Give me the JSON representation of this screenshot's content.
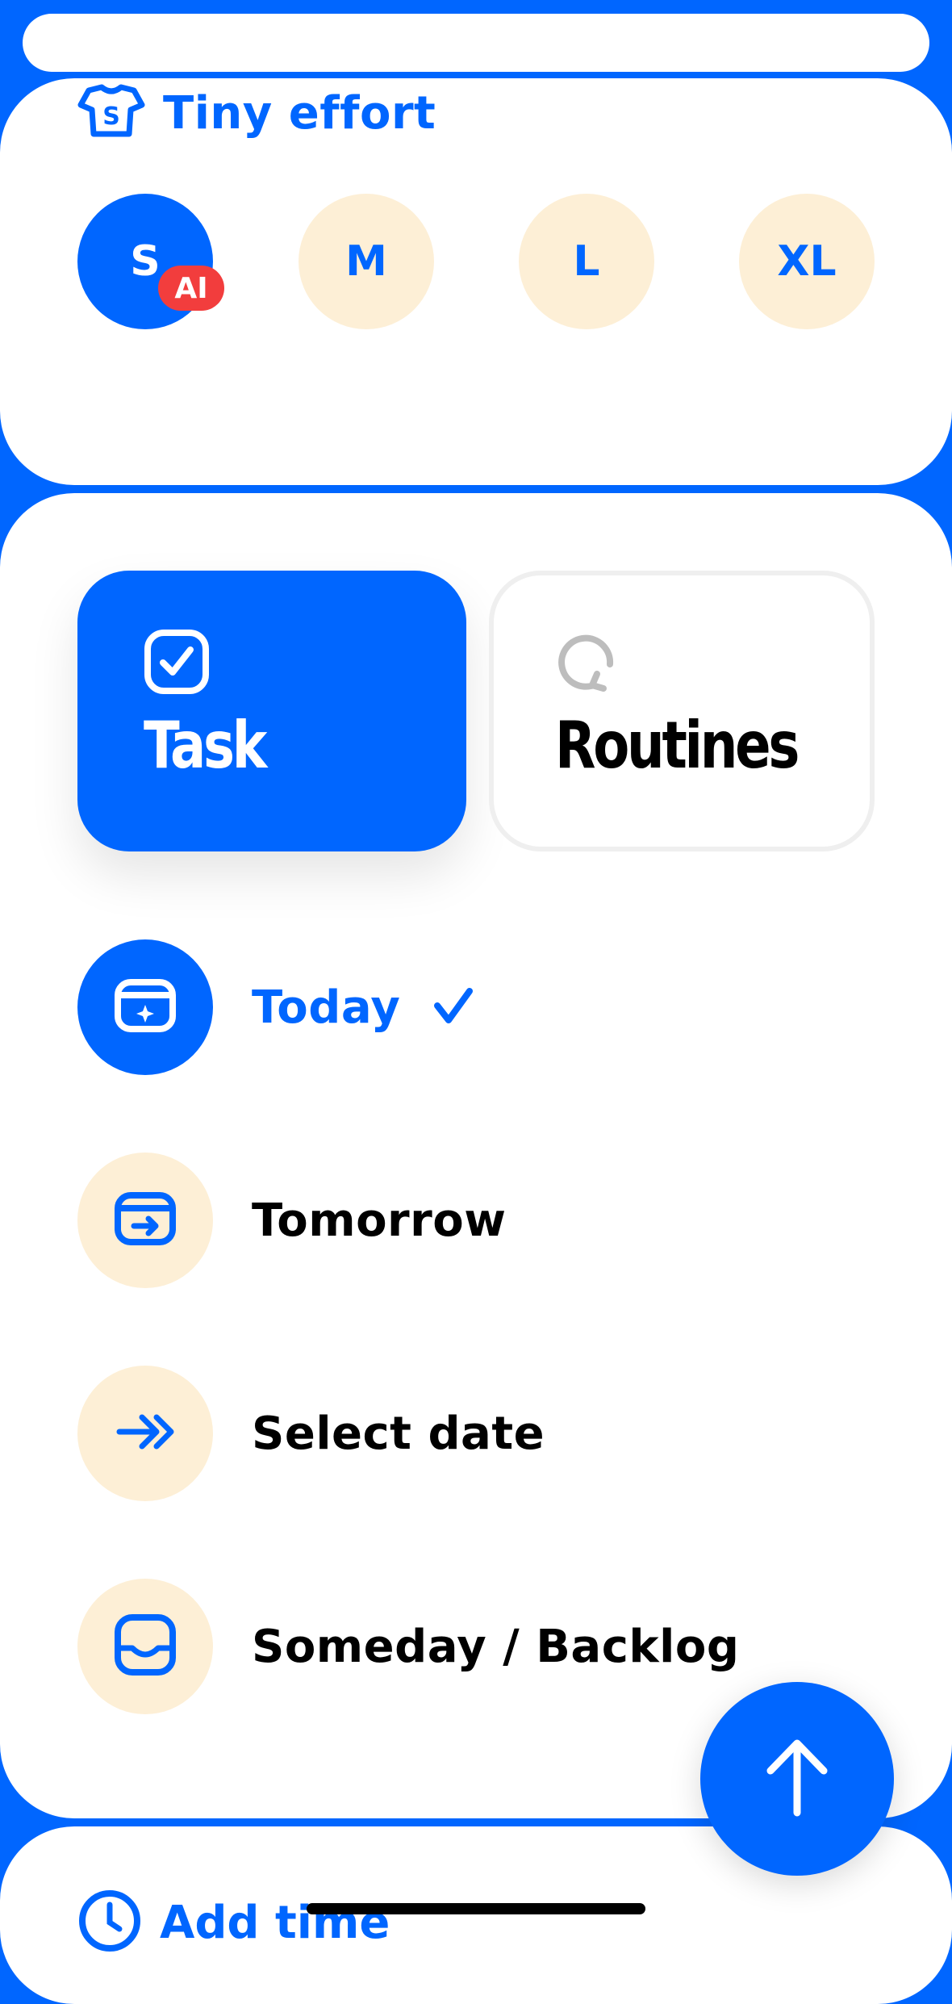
{
  "effort": {
    "title": "Tiny effort",
    "icon": "tshirt-icon",
    "sizes": [
      "S",
      "M",
      "L",
      "XL"
    ],
    "selected": "S",
    "ai_badge": "AI"
  },
  "mode": {
    "task_label": "Task",
    "routines_label": "Routines",
    "selected": "Task"
  },
  "when": {
    "options": [
      "Today",
      "Tomorrow",
      "Select date",
      "Someday / Backlog"
    ],
    "selected": "Today"
  },
  "time": {
    "label": "Add time"
  },
  "colors": {
    "accent": "#0066FF",
    "soft": "#FDEFD6",
    "badge": "#F23D3D"
  }
}
